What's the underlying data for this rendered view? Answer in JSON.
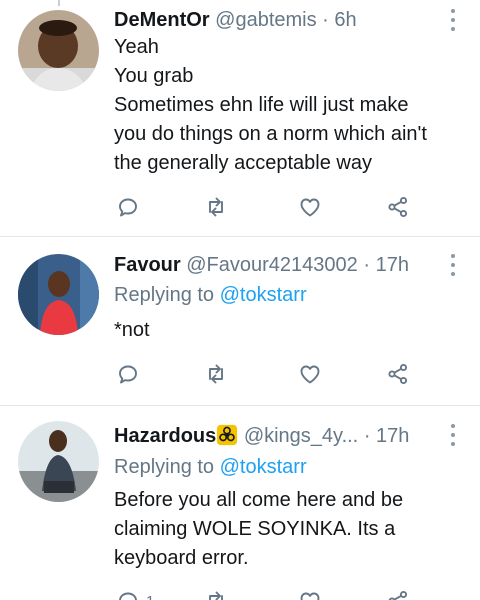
{
  "tweets": [
    {
      "name": "DeMentOr",
      "handle": "@gabtemis",
      "separator": "·",
      "time": "6h",
      "lines": [
        "Yeah",
        "You grab",
        "Sometimes ehn life will just make",
        "you do things on a norm which ain't",
        "the generally acceptable way"
      ]
    },
    {
      "name": "Favour",
      "handle": "@Favour42143002",
      "separator": "·",
      "time": "17h",
      "replying_prefix": "Replying to",
      "replying_to": "@tokstarr",
      "lines": [
        "*not"
      ]
    },
    {
      "name": "Hazardous",
      "name_badge_icon": "biohazard-icon",
      "handle": "@kings_4y...",
      "separator": "·",
      "time": "17h",
      "replying_prefix": "Replying to",
      "replying_to": "@tokstarr",
      "lines": [
        "Before you all come here and be",
        "claiming WOLE SOYINKA. Its a",
        "keyboard error."
      ],
      "reply_count": "1"
    }
  ],
  "colors": {
    "text": "#14171a",
    "secondary": "#657786",
    "link": "#1da1f2",
    "icon": "#657786",
    "divider": "#e1e8ed",
    "badge": "#f5c400"
  }
}
